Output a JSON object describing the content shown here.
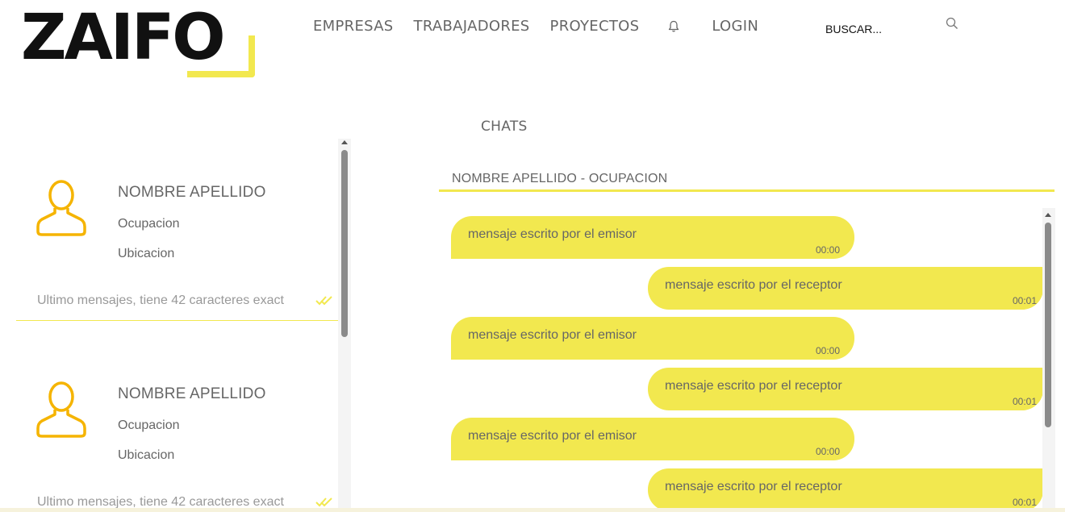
{
  "header": {
    "logo_text": "ZAIFO",
    "nav": {
      "empresas": "EMPRESAS",
      "trabajadores": "TRABAJADORES",
      "proyectos": "PROYECTOS",
      "login": "LOGIN"
    },
    "notification_icon": "bell-icon",
    "search": {
      "label": "BUSCAR...",
      "icon": "search-icon"
    }
  },
  "page": {
    "title": "CHATS"
  },
  "contacts": [
    {
      "name": "NOMBRE APELLIDO",
      "occupation": "Ocupacion",
      "location": "Ubicacion",
      "last_message": "Ultimo mensajes, tiene 42 caracteres exact",
      "status_icon": "double-check-icon"
    },
    {
      "name": "NOMBRE APELLIDO",
      "occupation": "Ocupacion",
      "location": "Ubicacion",
      "last_message": "Ultimo mensajes, tiene 42 caracteres exact",
      "status_icon": "double-check-icon"
    }
  ],
  "chat": {
    "header": "NOMBRE APELLIDO - OCUPACION",
    "messages": [
      {
        "direction": "sent",
        "text": "mensaje escrito por el emisor",
        "time": "00:00"
      },
      {
        "direction": "received",
        "text": "mensaje escrito por el receptor",
        "time": "00:01"
      },
      {
        "direction": "sent",
        "text": "mensaje escrito por el emisor",
        "time": "00:00"
      },
      {
        "direction": "received",
        "text": "mensaje escrito por el receptor",
        "time": "00:01"
      },
      {
        "direction": "sent",
        "text": "mensaje escrito por el emisor",
        "time": "00:00"
      },
      {
        "direction": "received",
        "text": "mensaje escrito por el receptor",
        "time": "00:01"
      }
    ]
  },
  "colors": {
    "accent": "#f2e84f",
    "avatar": "#f5b400",
    "text": "#666666",
    "logo": "#111111"
  }
}
